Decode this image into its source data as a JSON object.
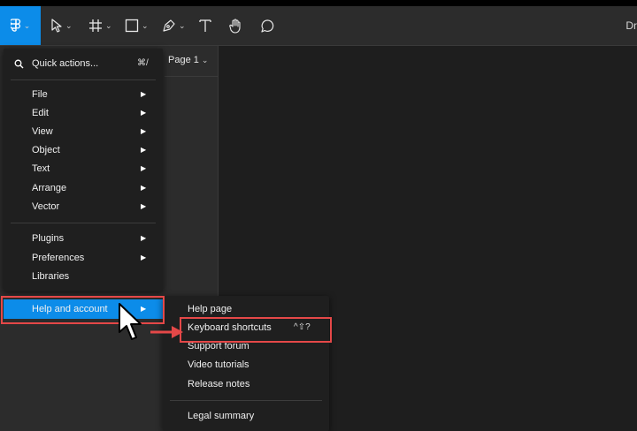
{
  "toolbar": {
    "doc_title_fragment": "Dr"
  },
  "page_selector": {
    "label": "Page 1"
  },
  "main_menu": {
    "quick_actions": {
      "label": "Quick actions...",
      "shortcut": "⌘/"
    },
    "group1": [
      "File",
      "Edit",
      "View",
      "Object",
      "Text",
      "Arrange",
      "Vector"
    ],
    "group2": [
      "Plugins",
      "Preferences",
      "Libraries"
    ],
    "help": {
      "label": "Help and account"
    }
  },
  "help_submenu": {
    "help_page": "Help page",
    "keyboard_shortcuts": {
      "label": "Keyboard shortcuts",
      "shortcut": "^⇧?"
    },
    "support_forum": "Support forum",
    "video_tutorials": "Video tutorials",
    "release_notes": "Release notes",
    "legal_summary": "Legal summary"
  },
  "colors": {
    "accent": "#0c8ce9",
    "highlight": "#e54848",
    "menu_bg": "#1f1f1f",
    "toolbar_bg": "#2c2c2c"
  }
}
